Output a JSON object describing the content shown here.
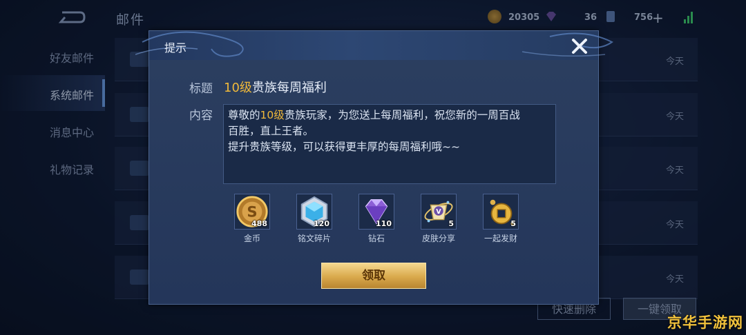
{
  "topbar": {
    "title": "邮件",
    "coins": "20305",
    "diamonds": "36",
    "vouchers": "756",
    "plus": "+"
  },
  "sidebar": {
    "items": [
      {
        "label": "好友邮件"
      },
      {
        "label": "系统邮件"
      },
      {
        "label": "消息中心"
      },
      {
        "label": "礼物记录"
      }
    ],
    "active_index": 1
  },
  "mail_list": {
    "rows": [
      {
        "date": "今天"
      },
      {
        "date": "今天"
      },
      {
        "date": "今天"
      },
      {
        "date": "今天"
      },
      {
        "date": "今天"
      }
    ]
  },
  "bottom": {
    "delete_label": "快速删除",
    "claim_all_label": "一键领取"
  },
  "modal": {
    "title": "提示",
    "subject_label": "标题",
    "subject_level": "10级",
    "subject_rest": "贵族每周福利",
    "content_label": "内容",
    "content_pre": "尊敬的",
    "content_level": "10级",
    "content_line1_rest": "贵族玩家，为您送上每周福利，祝您新的一周百战",
    "content_line2": "百胜，直上王者。",
    "content_line3": "提升贵族等级，可以获得更丰厚的每周福利哦~~",
    "rewards": [
      {
        "icon": "gold-coin-icon",
        "count": "488",
        "name": "金币"
      },
      {
        "icon": "inscription-shard-icon",
        "count": "120",
        "name": "铭文碎片"
      },
      {
        "icon": "diamond-icon",
        "count": "110",
        "name": "钻石"
      },
      {
        "icon": "skin-share-icon",
        "count": "5",
        "name": "皮肤分享"
      },
      {
        "icon": "fortune-coin-icon",
        "count": "5",
        "name": "一起发财"
      }
    ],
    "claim_label": "领取"
  },
  "watermark": "京华手游网",
  "colors": {
    "accent_gold": "#f0b93a",
    "button_gold": "#d9a94c",
    "panel": "#24365a"
  }
}
